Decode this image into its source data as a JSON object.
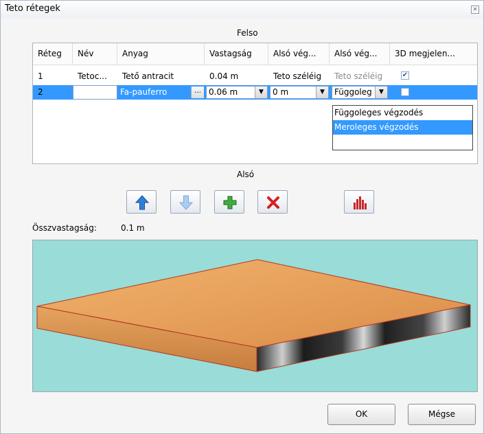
{
  "window": {
    "title": "Teto rétegek"
  },
  "labels": {
    "top": "Felso",
    "bottom": "Alsó",
    "total_label": "Összvastagság:",
    "total_value": "0.1 m"
  },
  "table": {
    "columns": [
      "Réteg",
      "Név",
      "Anyag",
      "Vastagság",
      "Alsó vég...",
      "Alsó vég...",
      "3D megjelen..."
    ],
    "rows": [
      {
        "layer": "1",
        "name": "Tetoc...",
        "material": "Tető antracit",
        "thickness": "0.04 m",
        "lower_end_1": "Teto széléig",
        "lower_end_2": "Teto széléig",
        "show_3d": true
      },
      {
        "layer": "2",
        "name": "",
        "material": "Fa-pauferro",
        "thickness": "0.06 m",
        "lower_end_1": "0 m",
        "lower_end_2": "Függoleg",
        "show_3d": false
      }
    ],
    "dropdown_options": [
      "Függoleges végzodés",
      "Meroleges végzodés"
    ],
    "dropdown_selected": "Meroleges végzodés"
  },
  "toolbar": {
    "icons": [
      "arrow-up-icon",
      "arrow-down-icon",
      "add-icon",
      "delete-icon",
      "chart-icon"
    ]
  },
  "buttons": {
    "ok": "OK",
    "cancel": "Mégse"
  },
  "colors": {
    "selection": "#3399ff",
    "preview_bg": "#99dcd8",
    "wood": "#e6a05c"
  }
}
